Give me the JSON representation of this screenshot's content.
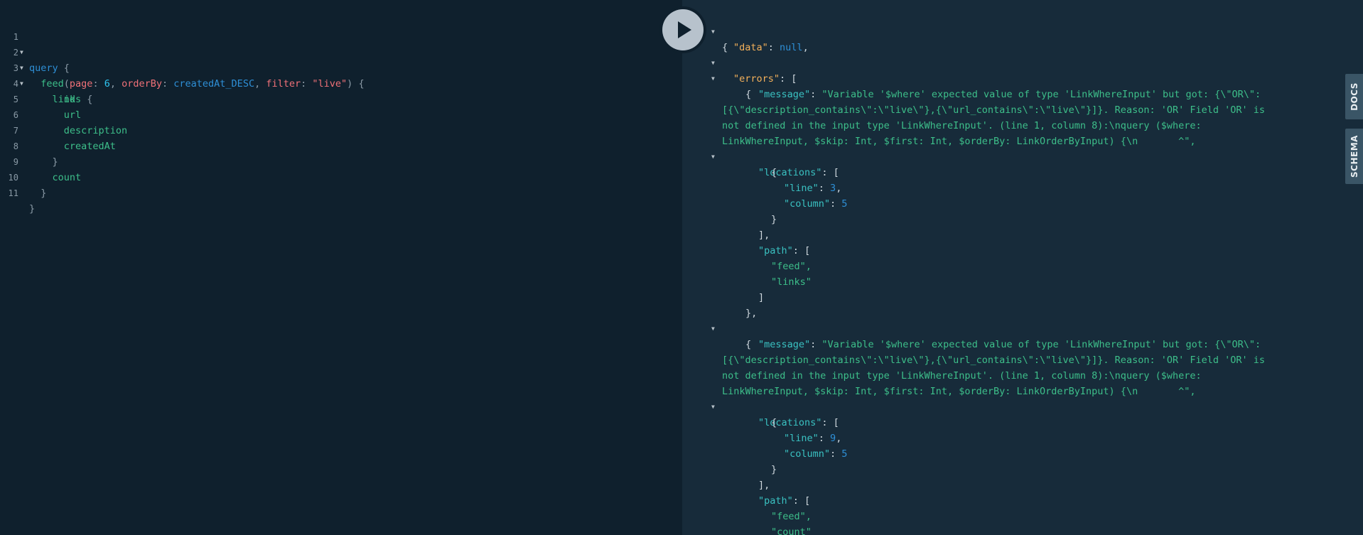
{
  "editor": {
    "line_numbers": [
      "1",
      "2",
      "3",
      "4",
      "5",
      "6",
      "7",
      "8",
      "9",
      "10",
      "11"
    ],
    "line1": {
      "keyword": "query",
      "brace": "{"
    },
    "line2": {
      "field": "feed",
      "open_paren": "(",
      "arg1_name": "page",
      "arg1_value": "6",
      "arg2_name": "orderBy",
      "arg2_value": "createdAt_DESC",
      "arg3_name": "filter",
      "arg3_value": "\"live\"",
      "close_paren": ")",
      "brace": "{"
    },
    "line3": {
      "field": "links",
      "brace": "{"
    },
    "line4": {
      "field": "id"
    },
    "line5": {
      "field": "url"
    },
    "line6": {
      "field": "description"
    },
    "line7": {
      "field": "createdAt"
    },
    "line8": {
      "brace": "}"
    },
    "line9": {
      "field": "count"
    },
    "line10": {
      "brace": "}"
    },
    "line11": {
      "brace": "}"
    }
  },
  "result": {
    "data_key": "\"data\"",
    "data_value": "null",
    "errors_key": "\"errors\"",
    "message_key": "\"message\"",
    "message_1_lines": [
      "\"Variable '$where' expected value of type 'LinkWhereInput' but got: {\\\"OR\\\":",
      "[{\\\"description_contains\\\":\\\"live\\\"},{\\\"url_contains\\\":\\\"live\\\"}]}. Reason: 'OR' Field 'OR' is",
      "not defined in the input type 'LinkWhereInput'. (line 1, column 8):\\nquery ($where:",
      "LinkWhereInput, $skip: Int, $first: Int, $orderBy: LinkOrderByInput) {\\n       ^\","
    ],
    "message_2_lines": [
      "\"Variable '$where' expected value of type 'LinkWhereInput' but got: {\\\"OR\\\":",
      "[{\\\"description_contains\\\":\\\"live\\\"},{\\\"url_contains\\\":\\\"live\\\"}]}. Reason: 'OR' Field 'OR' is",
      "not defined in the input type 'LinkWhereInput'. (line 1, column 8):\\nquery ($where:",
      "LinkWhereInput, $skip: Int, $first: Int, $orderBy: LinkOrderByInput) {\\n       ^\","
    ],
    "locations_key": "\"locations\"",
    "line_key": "\"line\"",
    "column_key": "\"column\"",
    "error1_line": "3",
    "error1_column": "5",
    "error2_line": "9",
    "error2_column": "5",
    "path_key": "\"path\"",
    "error1_path": [
      "\"feed\",",
      "\"links\""
    ],
    "error2_path": [
      "\"feed\",",
      "\"count\""
    ]
  },
  "side_tabs": {
    "docs": "DOCS",
    "schema": "SCHEMA"
  },
  "icons": {
    "run": "play-icon",
    "fold": "fold-arrow-icon"
  }
}
